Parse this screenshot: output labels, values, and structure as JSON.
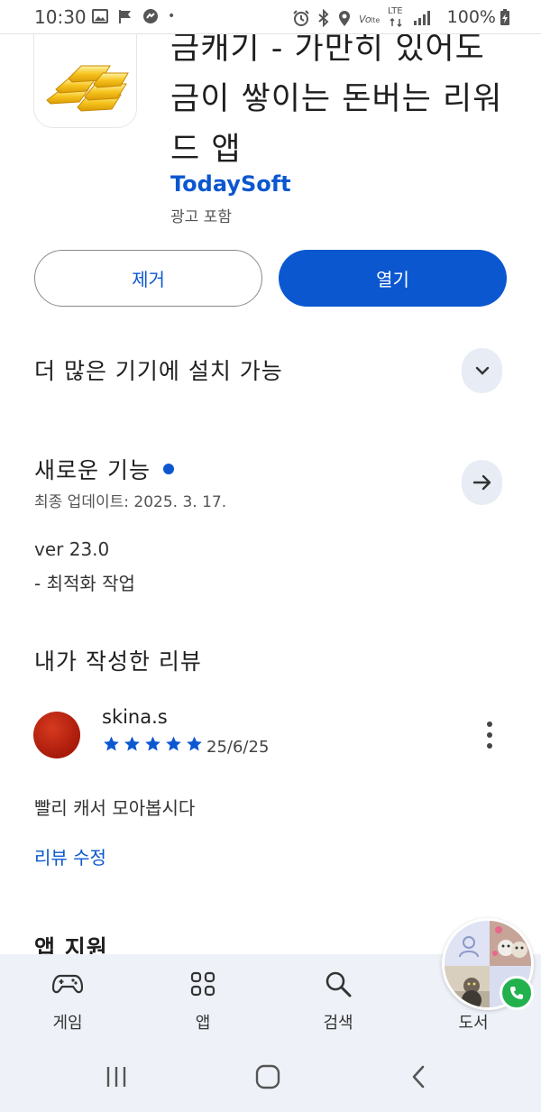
{
  "status_bar": {
    "time": "10:30",
    "dot": "•",
    "lte_label": "LTE",
    "battery": "100%"
  },
  "app": {
    "title": "금캐기 - 가만히 있어도 금이 쌓이는 돈버는 리워드 앱",
    "developer": "TodaySoft",
    "ad_label": "광고 포함",
    "icon": "gold-bars-icon"
  },
  "actions": {
    "remove_label": "제거",
    "open_label": "열기"
  },
  "devices": {
    "title": "더 많은 기기에 설치 가능"
  },
  "whats_new": {
    "title": "새로운 기능",
    "last_updated": "최종 업데이트: 2025. 3. 17.",
    "version": "ver 23.0",
    "notes": "- 최적화 작업"
  },
  "my_review": {
    "title": "내가 작성한 리뷰",
    "reviewer": "skina.s",
    "rating": 5,
    "date": "25/6/25",
    "text": "빨리 캐서 모아봅시다",
    "edit_label": "리뷰 수정"
  },
  "app_support": {
    "title": "앱 지원"
  },
  "bottom_nav": {
    "items": [
      {
        "label": "게임",
        "icon": "gamepad-icon"
      },
      {
        "label": "앱",
        "icon": "apps-grid-icon"
      },
      {
        "label": "검색",
        "icon": "search-icon"
      },
      {
        "label": "도서",
        "icon": "book-icon"
      }
    ]
  },
  "colors": {
    "accent": "#0b57d0",
    "nav_background": "#eef2f8",
    "call_badge": "#23b14d"
  }
}
